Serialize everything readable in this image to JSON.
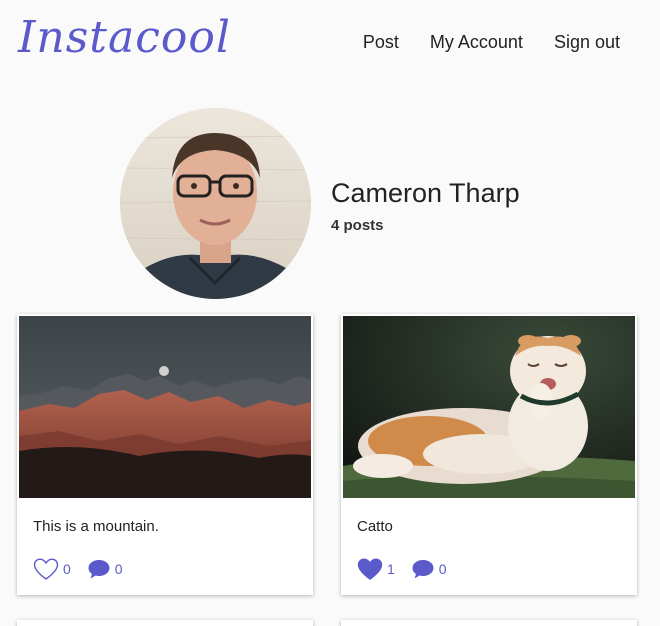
{
  "header": {
    "logo": "Instacool",
    "nav": [
      "Post",
      "My Account",
      "Sign out"
    ]
  },
  "profile": {
    "name": "Cameron Tharp",
    "post_count": "4",
    "post_label": "posts"
  },
  "posts": [
    {
      "caption": "This is a mountain.",
      "likes": "0",
      "comments": "0",
      "liked": false
    },
    {
      "caption": "Catto",
      "likes": "1",
      "comments": "0",
      "liked": true
    }
  ],
  "colors": {
    "accent": "#5a5acb",
    "background": "#fafafa"
  },
  "icons": {
    "like": "heart-icon",
    "comment": "comment-bubble-icon"
  }
}
